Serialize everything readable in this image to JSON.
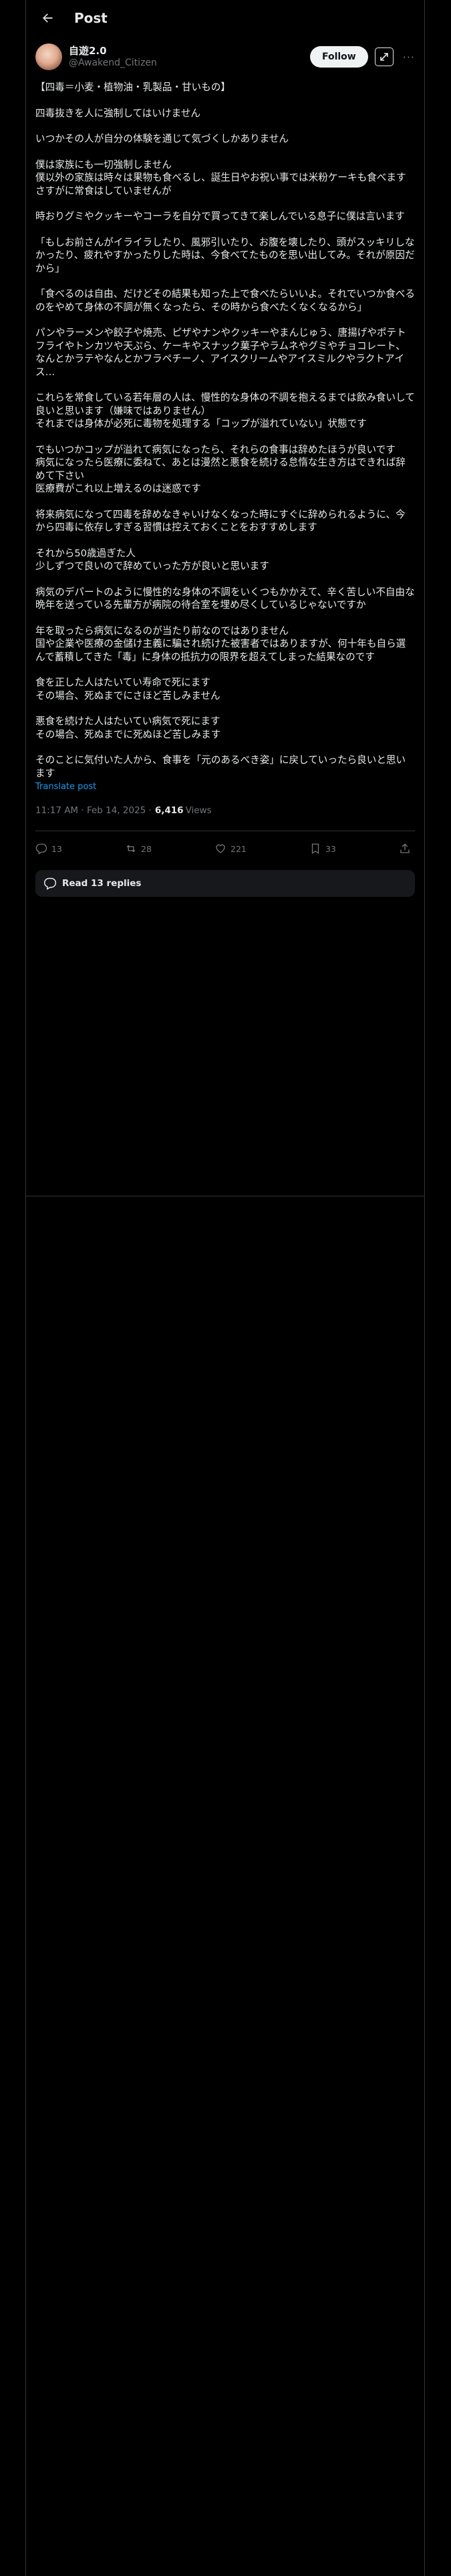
{
  "header": {
    "title": "Post",
    "back_icon": "arrow-left-icon"
  },
  "author": {
    "display_name": "自遊2.0",
    "handle": "@Awakend_Citizen",
    "follow_label": "Follow",
    "grok_icon": "grok-icon",
    "more_icon": "more-dots-icon",
    "more_text": "···"
  },
  "post": {
    "paragraphs": [
      "【四毒＝小麦・植物油・乳製品・甘いもの】",
      "四毒抜きを人に強制してはいけません",
      "いつかその人が自分の体験を通じて気づくしかありません",
      "僕は家族にも一切強制しません\n僕以外の家族は時々は果物も食べるし、誕生日やお祝い事では米粉ケーキも食べます\nさすがに常食はしていませんが",
      "時おりグミやクッキーやコーラを自分で買ってきて楽しんでいる息子に僕は言います",
      "「もしお前さんがイライラしたり、風邪引いたり、お腹を壊したり、頭がスッキリしなかったり、疲れやすかったりした時は、今食べてたものを思い出してみ。それが原因だから」",
      "「食べるのは自由、だけどその結果も知った上で食べたらいいよ。それでいつか食べるのをやめて身体の不調が無くなったら、その時から食べたくなくなるから」",
      "パンやラーメンや餃子や焼売、ピザやナンやクッキーやまんじゅう、唐揚げやポテトフライやトンカツや天ぷら、ケーキやスナック菓子やラムネやグミやチョコレート、なんとかラテやなんとかフラペチーノ、アイスクリームやアイスミルクやラクトアイス…",
      "これらを常食している若年層の人は、慢性的な身体の不調を抱えるまでは飲み食いして良いと思います（嫌味ではありません）\nそれまでは身体が必死に毒物を処理する「コップが溢れていない」状態です",
      "でもいつかコップが溢れて病気になったら、それらの食事は辞めたほうが良いです\n病気になったら医療に委ねて、あとは漫然と悪食を続ける怠惰な生き方はできれば辞めて下さい\n医療費がこれ以上増えるのは迷惑です",
      "将来病気になって四毒を辞めなきゃいけなくなった時にすぐに辞められるように、今から四毒に依存しすぎる習慣は控えておくことをおすすめします",
      "それから50歳過ぎた人\n少しずつで良いので辞めていった方が良いと思います",
      "病気のデパートのように慢性的な身体の不調をいくつもかかえて、辛く苦しい不自由な晩年を送っている先輩方が病院の待合室を埋め尽くしているじゃないですか",
      "年を取ったら病気になるのが当たり前なのではありません\n国や企業や医療の金儲け主義に騙され続けた被害者ではありますが、何十年も自ら選んで蓄積してきた「毒」に身体の抵抗力の限界を超えてしまった結果なのです",
      "食を正した人はたいてい寿命で死にます\nその場合、死ぬまでにさほど苦しみません",
      "悪食を続けた人はたいてい病気で死にます\nその場合、死ぬまでに死ぬほど苦しみます",
      "そのことに気付いた人から、食事を「元のあるべき姿」に戻していったら良いと思います"
    ],
    "translate_label": "Translate post",
    "timestamp": "11:17 AM · Feb 14, 2025 ·",
    "views_count": "6,416",
    "views_label": "Views"
  },
  "actions": {
    "reply_count": "13",
    "repost_count": "28",
    "like_count": "221",
    "bookmark_count": "33",
    "reply_icon": "reply-icon",
    "repost_icon": "repost-icon",
    "like_icon": "heart-icon",
    "bookmark_icon": "bookmark-icon",
    "share_icon": "share-icon"
  },
  "replies": {
    "label": "Read 13 replies",
    "icon": "reply-bubble-icon"
  },
  "colors": {
    "background": "#000000",
    "text": "#e7e9ea",
    "muted": "#71767b",
    "link": "#1d9bf0",
    "border": "#2f3336"
  }
}
